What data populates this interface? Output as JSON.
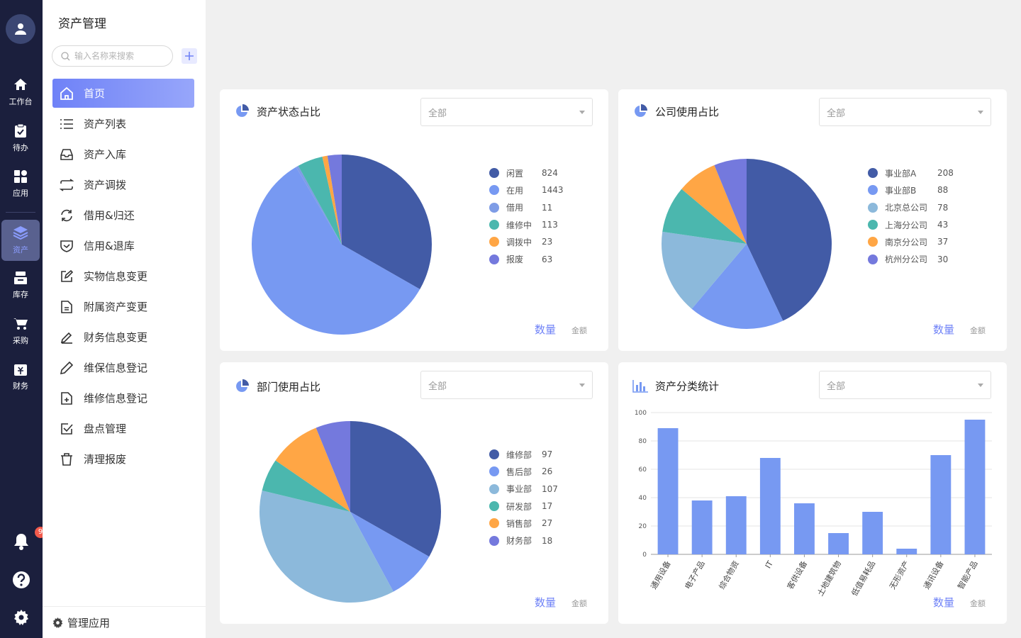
{
  "rail": {
    "items": [
      {
        "label": "工作台",
        "icon": "home-icon"
      },
      {
        "label": "待办",
        "icon": "clipboard-check-icon"
      },
      {
        "label": "应用",
        "icon": "apps-grid-icon"
      },
      {
        "label": "资产",
        "icon": "layers-icon"
      },
      {
        "label": "库存",
        "icon": "inbox-tray-icon"
      },
      {
        "label": "采购",
        "icon": "cart-icon"
      },
      {
        "label": "财务",
        "icon": "wallet-icon"
      }
    ],
    "notification_count": "9",
    "active_color": "#8b9dff"
  },
  "sidebar": {
    "title": "资产管理",
    "search_placeholder": "输入名称来搜索",
    "items": [
      {
        "label": "首页",
        "icon": "home-outline-icon"
      },
      {
        "label": "资产列表",
        "icon": "list-icon"
      },
      {
        "label": "资产入库",
        "icon": "inbox-icon"
      },
      {
        "label": "资产调拨",
        "icon": "transfer-icon"
      },
      {
        "label": "借用&归还",
        "icon": "refresh-icon"
      },
      {
        "label": "信用&退库",
        "icon": "shield-check-icon"
      },
      {
        "label": "实物信息变更",
        "icon": "edit-square-icon"
      },
      {
        "label": "附属资产变更",
        "icon": "file-icon"
      },
      {
        "label": "财务信息变更",
        "icon": "pen-icon"
      },
      {
        "label": "维保信息登记",
        "icon": "pencil-icon"
      },
      {
        "label": "维修信息登记",
        "icon": "file-plus-icon"
      },
      {
        "label": "盘点管理",
        "icon": "check-square-icon"
      },
      {
        "label": "清理报废",
        "icon": "trash-icon"
      }
    ],
    "footer_label": "管理应用"
  },
  "dashboard": {
    "select_value": "全部",
    "toggle_primary": "数量",
    "toggle_secondary": "金额"
  },
  "chart_data": [
    {
      "type": "pie",
      "title": "资产状态占比",
      "categories": [
        "闲置",
        "在用",
        "借用",
        "维修中",
        "调拨中",
        "报废"
      ],
      "values": [
        824,
        1443,
        11,
        113,
        23,
        63
      ],
      "colors": [
        "#425ba6",
        "#7799f2",
        "#7e9ce6",
        "#4bb7ae",
        "#ffa645",
        "#7479dd"
      ]
    },
    {
      "type": "pie",
      "title": "公司使用占比",
      "categories": [
        "事业部A",
        "事业部B",
        "北京总公司",
        "上海分公司",
        "南京分公司",
        "杭州分公司"
      ],
      "values": [
        208,
        88,
        78,
        43,
        37,
        30
      ],
      "colors": [
        "#425ba6",
        "#7799f2",
        "#8cb9db",
        "#4bb7ae",
        "#ffa645",
        "#7479dd"
      ]
    },
    {
      "type": "pie",
      "title": "部门使用占比",
      "categories": [
        "维修部",
        "售后部",
        "事业部",
        "研发部",
        "销售部",
        "财务部"
      ],
      "values": [
        97,
        26,
        107,
        17,
        27,
        18
      ],
      "colors": [
        "#425ba6",
        "#7799f2",
        "#8cb9db",
        "#4bb7ae",
        "#ffa645",
        "#7479dd"
      ]
    },
    {
      "type": "bar",
      "title": "资产分类统计",
      "categories": [
        "通用设备",
        "电子产品",
        "综合物资",
        "IT",
        "客供设备",
        "土地建筑物",
        "低值易耗品",
        "无形资产",
        "通讯设备",
        "智能产品"
      ],
      "values": [
        89,
        38,
        41,
        68,
        36,
        15,
        30,
        4,
        70,
        95
      ],
      "ylim": [
        0,
        100
      ],
      "yticks": [
        0,
        20,
        40,
        60,
        80,
        100
      ],
      "color": "#7799f2",
      "grid": true
    }
  ]
}
